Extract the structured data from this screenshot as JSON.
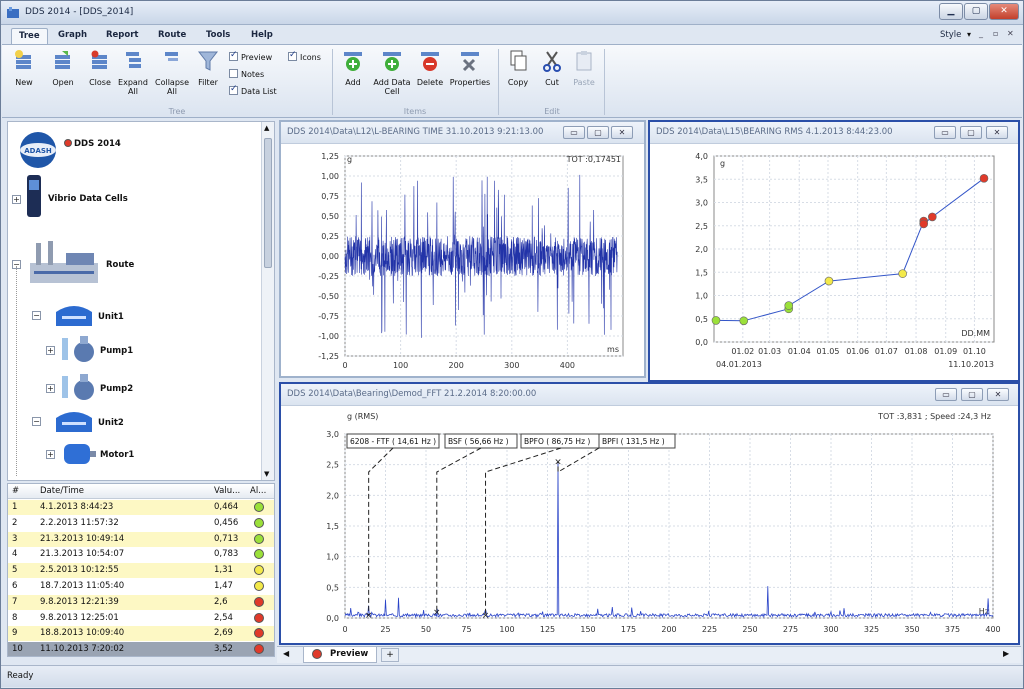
{
  "window": {
    "title": "DDS 2014 - [DDS_2014]",
    "minimize": "▁",
    "maximize": "▢",
    "close": "✕"
  },
  "menu": {
    "tabs": [
      "Tree",
      "Graph",
      "Report",
      "Route",
      "Tools",
      "Help"
    ],
    "style_label": "Style"
  },
  "ribbon": {
    "buttons": {
      "new": "New",
      "open": "Open",
      "close": "Close",
      "expand": "Expand All",
      "collapse": "Collapse All",
      "filter": "Filter",
      "add": "Add",
      "add_data_cell": "Add Data Cell",
      "delete": "Delete",
      "properties": "Properties",
      "copy": "Copy",
      "cut": "Cut",
      "paste": "Paste"
    },
    "checks": {
      "preview": "Preview",
      "icons": "Icons",
      "notes": "Notes",
      "data_list": "Data List"
    },
    "groups": {
      "tree": "Tree",
      "items": "Items",
      "edit": "Edit"
    }
  },
  "tree": {
    "root": "DDS 2014",
    "vibrio": "Vibrio Data Cells",
    "route": "Route",
    "unit1": "Unit1",
    "pump1": "Pump1",
    "pump2": "Pump2",
    "unit2": "Unit2",
    "motor1": "Motor1",
    "logo_text": "ADASH"
  },
  "list": {
    "headers": [
      "#",
      "Date/Time",
      "Valu...",
      "Al..."
    ],
    "rows": [
      {
        "n": "1",
        "date": "4.1.2013 8:44:23",
        "val": "0,464",
        "alarm": "green"
      },
      {
        "n": "2",
        "date": "2.2.2013 11:57:32",
        "val": "0,456",
        "alarm": "green"
      },
      {
        "n": "3",
        "date": "21.3.2013 10:49:14",
        "val": "0,713",
        "alarm": "green"
      },
      {
        "n": "4",
        "date": "21.3.2013 10:54:07",
        "val": "0,783",
        "alarm": "green"
      },
      {
        "n": "5",
        "date": "2.5.2013 10:12:55",
        "val": "1,31",
        "alarm": "yellow"
      },
      {
        "n": "6",
        "date": "18.7.2013 11:05:40",
        "val": "1,47",
        "alarm": "yellow"
      },
      {
        "n": "7",
        "date": "9.8.2013 12:21:39",
        "val": "2,6",
        "alarm": "red"
      },
      {
        "n": "8",
        "date": "9.8.2013 12:25:01",
        "val": "2,54",
        "alarm": "red"
      },
      {
        "n": "9",
        "date": "18.8.2013 10:09:40",
        "val": "2,69",
        "alarm": "red"
      },
      {
        "n": "10",
        "date": "11.10.2013 7:20:02",
        "val": "3,52",
        "alarm": "red"
      }
    ]
  },
  "colors": {
    "green": "#9be03a",
    "yellow": "#f3e94a",
    "red": "#e03a2a",
    "plot_blue": "#2233a8",
    "row_yellow": "#fdf8c4"
  },
  "time_chart": {
    "title": "DDS 2014\\Data\\L12\\L-BEARING TIME   31.10.2013 9:21:13.00",
    "unit": "g",
    "xunit": "ms",
    "tot": "TOT :0,17451",
    "yticks": [
      "1,25",
      "1,00",
      "0,75",
      "0,50",
      "0,25",
      "0,00",
      "-0,25",
      "-0,50",
      "-0,75",
      "-1,00",
      "-1,25"
    ],
    "xticks": [
      "0",
      "100",
      "200",
      "300",
      "400"
    ]
  },
  "trend_chart": {
    "title": "DDS 2014\\Data\\L15\\BEARING RMS   4.1.2013 8:44:23.00",
    "unit": "g",
    "mode": "DD.MM",
    "yticks": [
      "4,0",
      "3,5",
      "3,0",
      "2,5",
      "2,0",
      "1,5",
      "1,0",
      "0,5",
      "0,0"
    ],
    "xticks": [
      "01.02",
      "01.03",
      "01.04",
      "01.05",
      "01.06",
      "01.07",
      "01.08",
      "01.09",
      "01.10"
    ],
    "start": "04.01.2013",
    "end": "11.10.2013"
  },
  "fft_chart": {
    "title": "DDS 2014\\Data\\Bearing\\Demod_FFT   21.2.2014 8:20:00.00",
    "unit": "g  (RMS)",
    "xunit": "Hz",
    "info": "TOT :3,831 ;  Speed :24,3 Hz",
    "yticks": [
      "3,0",
      "2,5",
      "2,0",
      "1,5",
      "1,0",
      "0,5",
      "0,0"
    ],
    "xticks": [
      "0",
      "25",
      "50",
      "75",
      "100",
      "125",
      "150",
      "175",
      "200",
      "225",
      "250",
      "275",
      "300",
      "325",
      "350",
      "375",
      "400"
    ],
    "markers": [
      "6208 - FTF  ( 14,61 Hz )",
      "BSF  ( 56,66 Hz )",
      "BPFO  ( 86,75 Hz )",
      "BPFI  ( 131,5 Hz )"
    ]
  },
  "chart_data": [
    {
      "type": "line",
      "title": "DDS 2014\\Data\\L15\\BEARING RMS   4.1.2013 8:44:23.00",
      "ylabel": "g",
      "x": [
        "4.1.2013",
        "2.2.2013",
        "21.3.2013",
        "21.3.2013",
        "2.5.2013",
        "18.7.2013",
        "9.8.2013",
        "9.8.2013",
        "18.8.2013",
        "11.10.2013"
      ],
      "values": [
        0.464,
        0.456,
        0.713,
        0.783,
        1.31,
        1.47,
        2.6,
        2.54,
        2.69,
        3.52
      ],
      "ylim": [
        0,
        4
      ]
    },
    {
      "type": "line",
      "title": "DDS 2014\\Data\\Bearing\\Demod_FFT   21.2.2014 8:20:00.00",
      "xlabel": "Hz",
      "ylabel": "g (RMS)",
      "peaks_x": [
        14.61,
        25,
        33,
        57,
        86.75,
        131.5,
        156,
        165,
        261,
        290,
        300,
        397
      ],
      "peaks_y": [
        0.2,
        0.3,
        0.33,
        0.15,
        0.12,
        2.55,
        0.15,
        0.18,
        0.52,
        0.1,
        0.1,
        0.32
      ],
      "xlim": [
        0,
        400
      ],
      "ylim": [
        0,
        3
      ]
    }
  ],
  "tabs": {
    "preview": "Preview",
    "add": "+"
  },
  "status": "Ready"
}
